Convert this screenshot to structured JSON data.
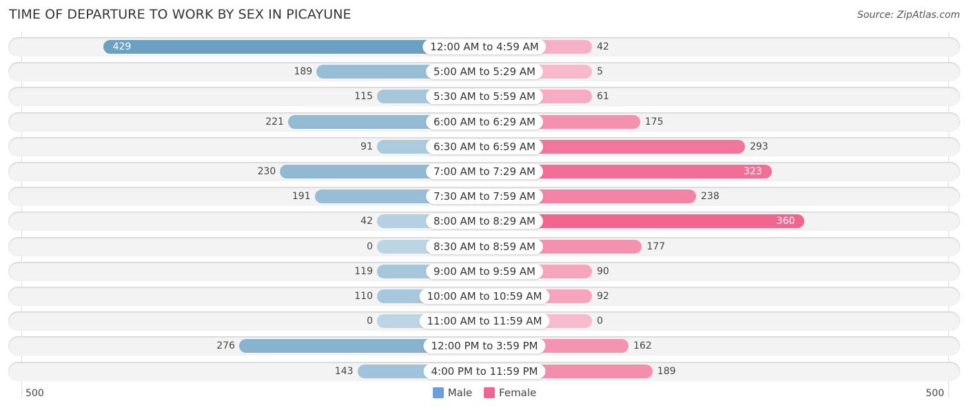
{
  "chart_data": {
    "type": "bar",
    "orientation": "horizontal-diverging",
    "title": "TIME OF DEPARTURE TO WORK BY SEX IN PICAYUNE",
    "source": "Source: ZipAtlas.com",
    "categories": [
      "12:00 AM to 4:59 AM",
      "5:00 AM to 5:29 AM",
      "5:30 AM to 5:59 AM",
      "6:00 AM to 6:29 AM",
      "6:30 AM to 6:59 AM",
      "7:00 AM to 7:29 AM",
      "7:30 AM to 7:59 AM",
      "8:00 AM to 8:29 AM",
      "8:30 AM to 8:59 AM",
      "9:00 AM to 9:59 AM",
      "10:00 AM to 10:59 AM",
      "11:00 AM to 11:59 AM",
      "12:00 PM to 3:59 PM",
      "4:00 PM to 11:59 PM"
    ],
    "series": [
      {
        "name": "Male",
        "color": "#6a9fdb",
        "values": [
          429,
          189,
          115,
          221,
          91,
          230,
          191,
          42,
          0,
          119,
          110,
          0,
          276,
          143
        ]
      },
      {
        "name": "Female",
        "color": "#f06690",
        "values": [
          42,
          5,
          61,
          175,
          293,
          323,
          238,
          360,
          177,
          90,
          92,
          0,
          162,
          189
        ]
      }
    ],
    "axis": {
      "left_label": "500",
      "right_label": "500",
      "range": [
        0,
        500
      ]
    },
    "legend": {
      "position": "bottom-center",
      "entries": [
        "Male",
        "Female"
      ]
    }
  }
}
